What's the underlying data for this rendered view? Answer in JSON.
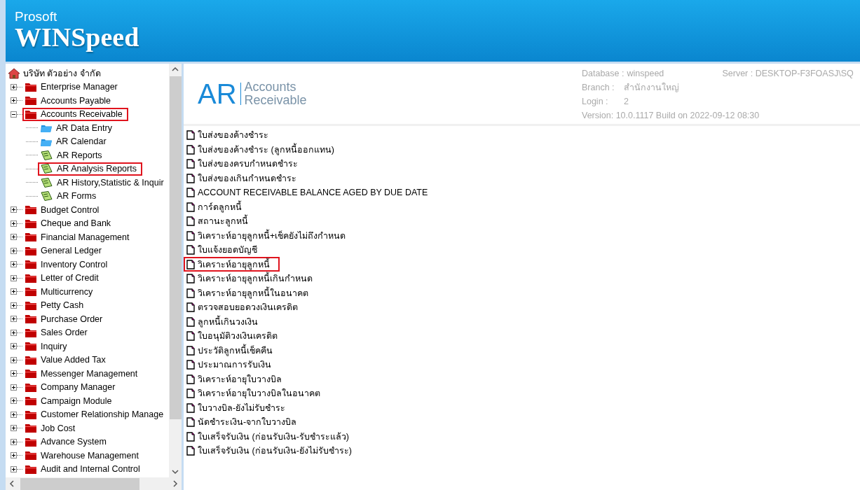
{
  "header": {
    "company": "Prosoft",
    "product": "WINSpeed"
  },
  "tree": {
    "label": "บริษัท ตัวอย่าง จำกัด",
    "children": [
      {
        "label": "Enterprise Manager",
        "kind": "module",
        "expanded": false,
        "highlighted": false
      },
      {
        "label": "Accounts Payable",
        "kind": "module",
        "expanded": false,
        "highlighted": false
      },
      {
        "label": "Accounts Receivable",
        "kind": "module",
        "expanded": true,
        "highlighted": true,
        "children": [
          {
            "label": "AR Data Entry",
            "kind": "entry",
            "highlighted": false
          },
          {
            "label": "AR Calendar",
            "kind": "entry",
            "highlighted": false
          },
          {
            "label": "AR Reports",
            "kind": "report",
            "highlighted": false
          },
          {
            "label": "AR Analysis Reports",
            "kind": "report",
            "highlighted": true
          },
          {
            "label": "AR History,Statistic & Inquir",
            "kind": "report",
            "highlighted": false
          },
          {
            "label": "AR Forms",
            "kind": "report",
            "highlighted": false
          }
        ]
      },
      {
        "label": "Budget Control",
        "kind": "module",
        "expanded": false,
        "highlighted": false
      },
      {
        "label": "Cheque and Bank",
        "kind": "module",
        "expanded": false,
        "highlighted": false
      },
      {
        "label": "Financial Management",
        "kind": "module",
        "expanded": false,
        "highlighted": false
      },
      {
        "label": "General Ledger",
        "kind": "module",
        "expanded": false,
        "highlighted": false
      },
      {
        "label": "Inventory Control",
        "kind": "module",
        "expanded": false,
        "highlighted": false
      },
      {
        "label": "Letter of Credit",
        "kind": "module",
        "expanded": false,
        "highlighted": false
      },
      {
        "label": "Multicurrency",
        "kind": "module",
        "expanded": false,
        "highlighted": false
      },
      {
        "label": "Petty Cash",
        "kind": "module",
        "expanded": false,
        "highlighted": false
      },
      {
        "label": "Purchase Order",
        "kind": "module",
        "expanded": false,
        "highlighted": false
      },
      {
        "label": "Sales Order",
        "kind": "module",
        "expanded": false,
        "highlighted": false
      },
      {
        "label": "Inquiry",
        "kind": "module",
        "expanded": false,
        "highlighted": false
      },
      {
        "label": "Value Added Tax",
        "kind": "module",
        "expanded": false,
        "highlighted": false
      },
      {
        "label": "Messenger Management",
        "kind": "module",
        "expanded": false,
        "highlighted": false
      },
      {
        "label": "Company Manager",
        "kind": "module",
        "expanded": false,
        "highlighted": false
      },
      {
        "label": "Campaign Module",
        "kind": "module",
        "expanded": false,
        "highlighted": false
      },
      {
        "label": "Customer Relationship Manage",
        "kind": "module",
        "expanded": false,
        "highlighted": false
      },
      {
        "label": "Job Cost",
        "kind": "module",
        "expanded": false,
        "highlighted": false
      },
      {
        "label": "Advance System",
        "kind": "module",
        "expanded": false,
        "highlighted": false
      },
      {
        "label": "Warehouse Management",
        "kind": "module",
        "expanded": false,
        "highlighted": false
      },
      {
        "label": "Audit and Internal Control",
        "kind": "module",
        "expanded": false,
        "highlighted": false
      }
    ]
  },
  "module": {
    "abbr": "AR",
    "name_line_1": "Accounts",
    "name_line_2": "Receivable"
  },
  "info": {
    "database_label": "Database :",
    "database": "winspeed",
    "server": "Server : DESKTOP-F3FOASJ\\SQ",
    "branch_label": "Branch :",
    "branch": "สำนักงานใหญ่",
    "login_label": "Login :",
    "login": "2",
    "version": "Version: 10.0.1117  Build on 2022-09-12 08:30"
  },
  "reports": [
    {
      "label": "ใบส่งของค้างชำระ",
      "highlighted": false
    },
    {
      "label": "ใบส่งของค้างชำระ (ลูกหนี้ออกแทน)",
      "highlighted": false
    },
    {
      "label": "ใบส่งของครบกำหนดชำระ",
      "highlighted": false
    },
    {
      "label": "ใบส่งของเกินกำหนดชำระ",
      "highlighted": false
    },
    {
      "label": "ACCOUNT RECEIVABLE BALANCE AGED BY DUE DATE",
      "highlighted": false
    },
    {
      "label": "การ์ดลูกหนี้",
      "highlighted": false
    },
    {
      "label": "สถานะลูกหนี้",
      "highlighted": false
    },
    {
      "label": "วิเคราะห์อายุลูกหนี้+เช็คยังไม่ถึงกำหนด",
      "highlighted": false
    },
    {
      "label": "ใบแจ้งยอดบัญชี",
      "highlighted": false
    },
    {
      "label": "วิเคราะห์อายุลูกหนี้",
      "highlighted": true
    },
    {
      "label": "วิเคราะห์อายุลูกหนี้เกินกำหนด",
      "highlighted": false
    },
    {
      "label": "วิเคราะห์อายุลูกหนี้ในอนาคต",
      "highlighted": false
    },
    {
      "label": "ตรวจสอบยอดวงเงินเครดิต",
      "highlighted": false
    },
    {
      "label": "ลูกหนี้เกินวงเงิน",
      "highlighted": false
    },
    {
      "label": "ใบอนุมัติวงเงินเครดิต",
      "highlighted": false
    },
    {
      "label": "ประวัติลูกหนี้เช็คคืน",
      "highlighted": false
    },
    {
      "label": "ประมาณการรับเงิน",
      "highlighted": false
    },
    {
      "label": "วิเคราะห์อายุใบวางบิล",
      "highlighted": false
    },
    {
      "label": "วิเคราะห์อายุใบวางบิลในอนาคต",
      "highlighted": false
    },
    {
      "label": "ใบวางบิล-ยังไม่รับชำระ",
      "highlighted": false
    },
    {
      "label": "นัดชำระเงิน-จากใบวางบิล",
      "highlighted": false
    },
    {
      "label": "ใบเสร็จรับเงิน (ก่อนรับเงิน-รับชำระแล้ว)",
      "highlighted": false
    },
    {
      "label": "ใบเสร็จรับเงิน (ก่อนรับเงิน-ยังไม่รับชำระ)",
      "highlighted": false
    }
  ]
}
